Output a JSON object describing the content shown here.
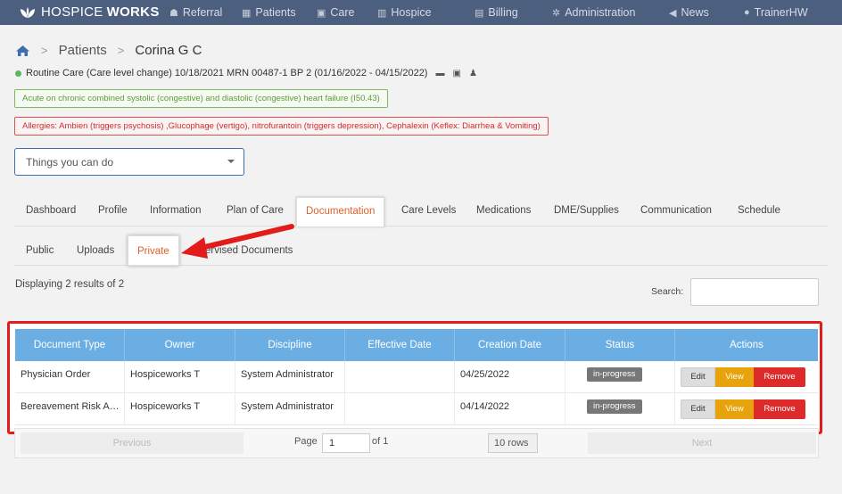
{
  "nav": {
    "brand_light": "HOSPICE",
    "brand_bold": "WORKS",
    "items": [
      {
        "icon": "referral-icon",
        "glyph": "☗",
        "label": "Referral"
      },
      {
        "icon": "patients-icon",
        "glyph": "▦",
        "label": "Patients"
      },
      {
        "icon": "care-icon",
        "glyph": "▣",
        "label": "Care"
      },
      {
        "icon": "hospice-icon",
        "glyph": "▥",
        "label": "Hospice"
      },
      {
        "icon": "billing-icon",
        "glyph": "▤",
        "label": "Billing"
      },
      {
        "icon": "administration-icon",
        "glyph": "✲",
        "label": "Administration"
      },
      {
        "icon": "news-icon",
        "glyph": "◀",
        "label": "News"
      },
      {
        "icon": "user-icon",
        "glyph": "●",
        "label": "TrainerHW"
      }
    ]
  },
  "breadcrumb": {
    "home_icon": "home-icon",
    "patients": "Patients",
    "current": "Corina G C"
  },
  "patient": {
    "status_color": "#5cb85c",
    "summary": "Routine Care (Care level change) 10/18/2021 MRN 00487-1 BP 2 (01/16/2022 - 04/15/2022)"
  },
  "diagnosis": "Acute on chronic combined systolic (congestive) and diastolic (congestive) heart failure (I50.43)",
  "allergies": "Allergies: Ambien (triggers psychosis) ,Glucophage (vertigo), nitrofurantoin (triggers depression), Cephalexin (Keflex: Diarrhea & Vomiting)",
  "things_dropdown": "Things you can do",
  "tabs": [
    "Dashboard",
    "Profile",
    "Information",
    "Plan of Care",
    "Documentation",
    "Care Levels",
    "Medications",
    "DME/Supplies",
    "Communication",
    "Schedule"
  ],
  "subtabs": {
    "public": "Public",
    "uploads": "Uploads",
    "private": "Private",
    "supervised": "ervised Documents"
  },
  "displaying": "Displaying 2 results of 2",
  "search_label": "Search:",
  "table": {
    "headers": [
      "Document Type",
      "Owner",
      "Discipline",
      "Effective Date",
      "Creation Date",
      "Status",
      "Actions"
    ],
    "rows": [
      {
        "type": "Physician Order",
        "owner": "Hospiceworks T",
        "discipline": "System Administrator",
        "effective": "",
        "created": "04/25/2022",
        "status": "in-progress"
      },
      {
        "type": "Bereavement Risk Assessment",
        "owner": "Hospiceworks T",
        "discipline": "System Administrator",
        "effective": "",
        "created": "04/14/2022",
        "status": "in-progress"
      }
    ],
    "btn_edit": "Edit",
    "btn_view": "View",
    "btn_remove": "Remove"
  },
  "pager": {
    "previous": "Previous",
    "page_label": "Page",
    "page_value": "1",
    "of_label": "of 1",
    "rows_label": "10 rows",
    "next": "Next"
  },
  "colors": {
    "nav_bg": "#4d5f7f",
    "accent_orange": "#e0602e",
    "table_header": "#6aaee3",
    "highlight_red": "#e21b1b",
    "view_btn": "#e8a20c",
    "remove_btn": "#dd2b2b"
  }
}
